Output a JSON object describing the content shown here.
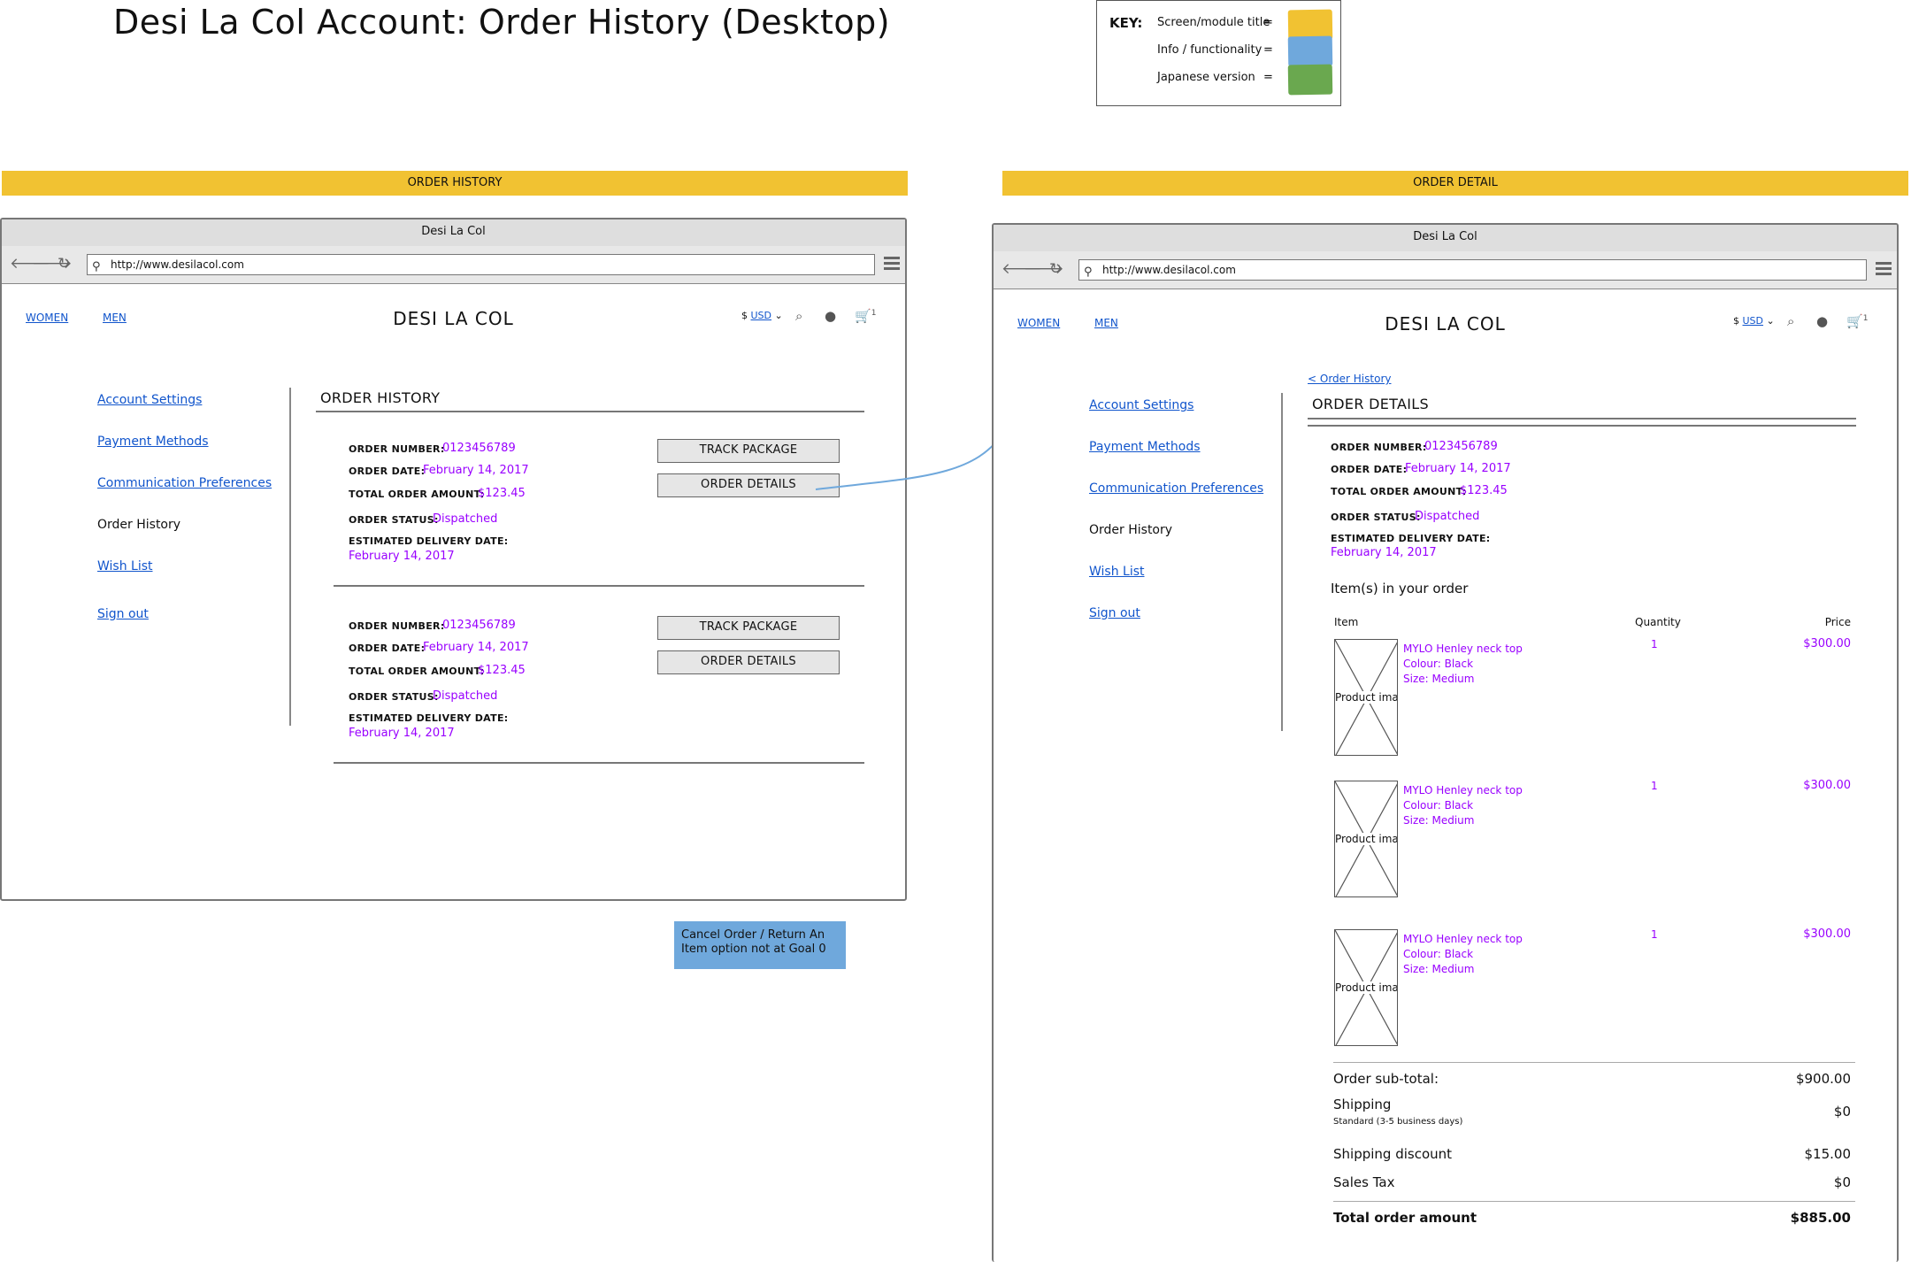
{
  "title": "Desi La Col Account: Order History (Desktop)",
  "key": {
    "heading": "KEY:",
    "items": [
      {
        "label": "Screen/module title",
        "color": "#f1c232"
      },
      {
        "label": "Info / functionality",
        "color": "#6fa8dc"
      },
      {
        "label": "Japanese version",
        "color": "#6aa84f"
      }
    ],
    "eq": "="
  },
  "banners": {
    "left": "ORDER HISTORY",
    "right": "ORDER DETAIL"
  },
  "browser": {
    "title": "Desi La Col",
    "url": "http://www.desilacol.com",
    "back": "🡐",
    "forward": "🡒",
    "reload": "↻",
    "search_glyph": "⚲"
  },
  "site": {
    "nav": [
      "WOMEN",
      "MEN"
    ],
    "logo": "DESI LA COL",
    "currency_symbol": "$",
    "currency": "USD",
    "cart_count": "1"
  },
  "sidebar": {
    "items": [
      "Account Settings",
      "Payment Methods",
      "Communication Preferences",
      "Order History",
      "Wish List",
      "Sign out"
    ]
  },
  "labels": {
    "order_number": "ORDER NUMBER:",
    "order_date": "ORDER DATE:",
    "total": "TOTAL ORDER AMOUNT:",
    "status": "ORDER STATUS:",
    "delivery": "ESTIMATED DELIVERY DATE:",
    "track": "TRACK PACKAGE",
    "details": "ORDER DETAILS"
  },
  "order_history": {
    "heading": "ORDER HISTORY",
    "orders": [
      {
        "number": "0123456789",
        "date": "February 14, 2017",
        "total": "$123.45",
        "status": "Dispatched",
        "delivery": "February 14, 2017"
      },
      {
        "number": "0123456789",
        "date": "February 14, 2017",
        "total": "$123.45",
        "status": "Dispatched",
        "delivery": "February 14, 2017"
      }
    ]
  },
  "note": "Cancel Order / Return An Item option not at Goal 0",
  "order_detail": {
    "back_link": "< Order History",
    "heading": "ORDER DETAILS",
    "number": "0123456789",
    "date": "February 14, 2017",
    "total": "$123.45",
    "status": "Dispatched",
    "delivery": "February 14, 2017",
    "items_heading": "Item(s) in your order",
    "columns": [
      "Item",
      "Quantity",
      "Price"
    ],
    "items": [
      {
        "image": "Product image",
        "name": "MYLO Henley neck top",
        "colour": "Colour: Black",
        "size": "Size: Medium",
        "qty": "1",
        "price": "$300.00"
      },
      {
        "image": "Product image",
        "name": "MYLO Henley neck top",
        "colour": "Colour: Black",
        "size": "Size: Medium",
        "qty": "1",
        "price": "$300.00"
      },
      {
        "image": "Product image",
        "name": "MYLO Henley neck top",
        "colour": "Colour: Black",
        "size": "Size: Medium",
        "qty": "1",
        "price": "$300.00"
      }
    ],
    "totals": {
      "subtotal_label": "Order sub-total:",
      "subtotal": "$900.00",
      "shipping_label": "Shipping",
      "shipping_note": "Standard (3-5 business days)",
      "shipping": "$0",
      "discount_label": "Shipping discount",
      "discount": "$15.00",
      "tax_label": "Sales Tax",
      "tax": "$0",
      "total_label": "Total order amount",
      "total": "$885.00"
    }
  }
}
